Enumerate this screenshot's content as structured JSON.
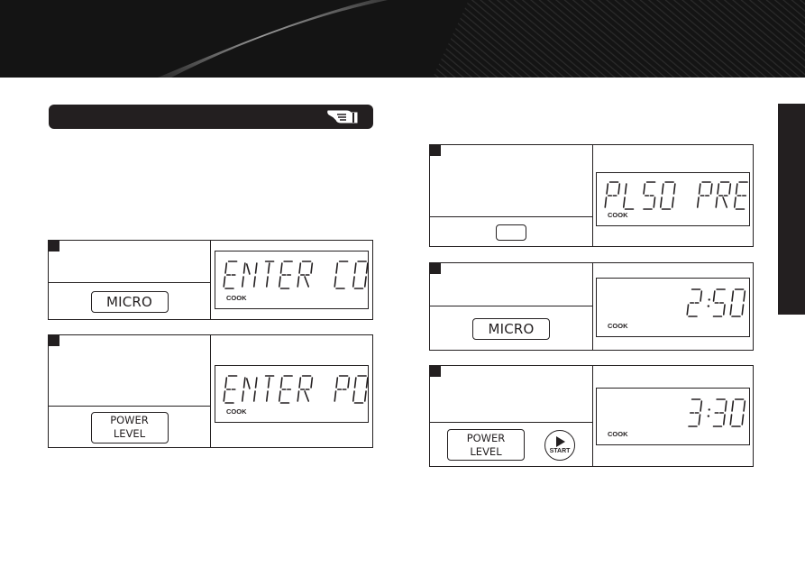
{
  "header": {
    "colors": {
      "background": "#141414",
      "accent_stripe": "#8a8a8a"
    }
  },
  "section": {
    "title": "",
    "icon": "pointing-hand-icon"
  },
  "side_tab": {
    "label": ""
  },
  "left_steps": [
    {
      "number": "",
      "instruction": "",
      "buttons": [
        {
          "type": "key",
          "label": "MICRO"
        }
      ],
      "display": {
        "text": "ENTER CO",
        "indicator": "COOK",
        "align": "left"
      }
    },
    {
      "number": "",
      "instruction": "",
      "buttons": [
        {
          "type": "key",
          "label_lines": [
            "POWER",
            "LEVEL"
          ]
        }
      ],
      "display": {
        "text": "ENTER PO",
        "indicator": "COOK",
        "align": "left"
      }
    }
  ],
  "right_steps": [
    {
      "number": "",
      "instruction": "",
      "buttons": [
        {
          "type": "blank-key",
          "label": ""
        }
      ],
      "display": {
        "text": "PL50 PRE",
        "indicator": "COOK",
        "align": "left"
      }
    },
    {
      "number": "",
      "instruction": "",
      "buttons": [
        {
          "type": "key",
          "label": "MICRO"
        }
      ],
      "display": {
        "text": "2:50",
        "indicator": "COOK",
        "align": "right"
      }
    },
    {
      "number": "",
      "instruction": "",
      "buttons": [
        {
          "type": "key",
          "label_lines": [
            "POWER",
            "LEVEL"
          ]
        },
        {
          "type": "start",
          "label": "START",
          "icon": "play-icon"
        }
      ],
      "display": {
        "text": "3:30",
        "indicator": "COOK",
        "align": "right"
      }
    }
  ]
}
